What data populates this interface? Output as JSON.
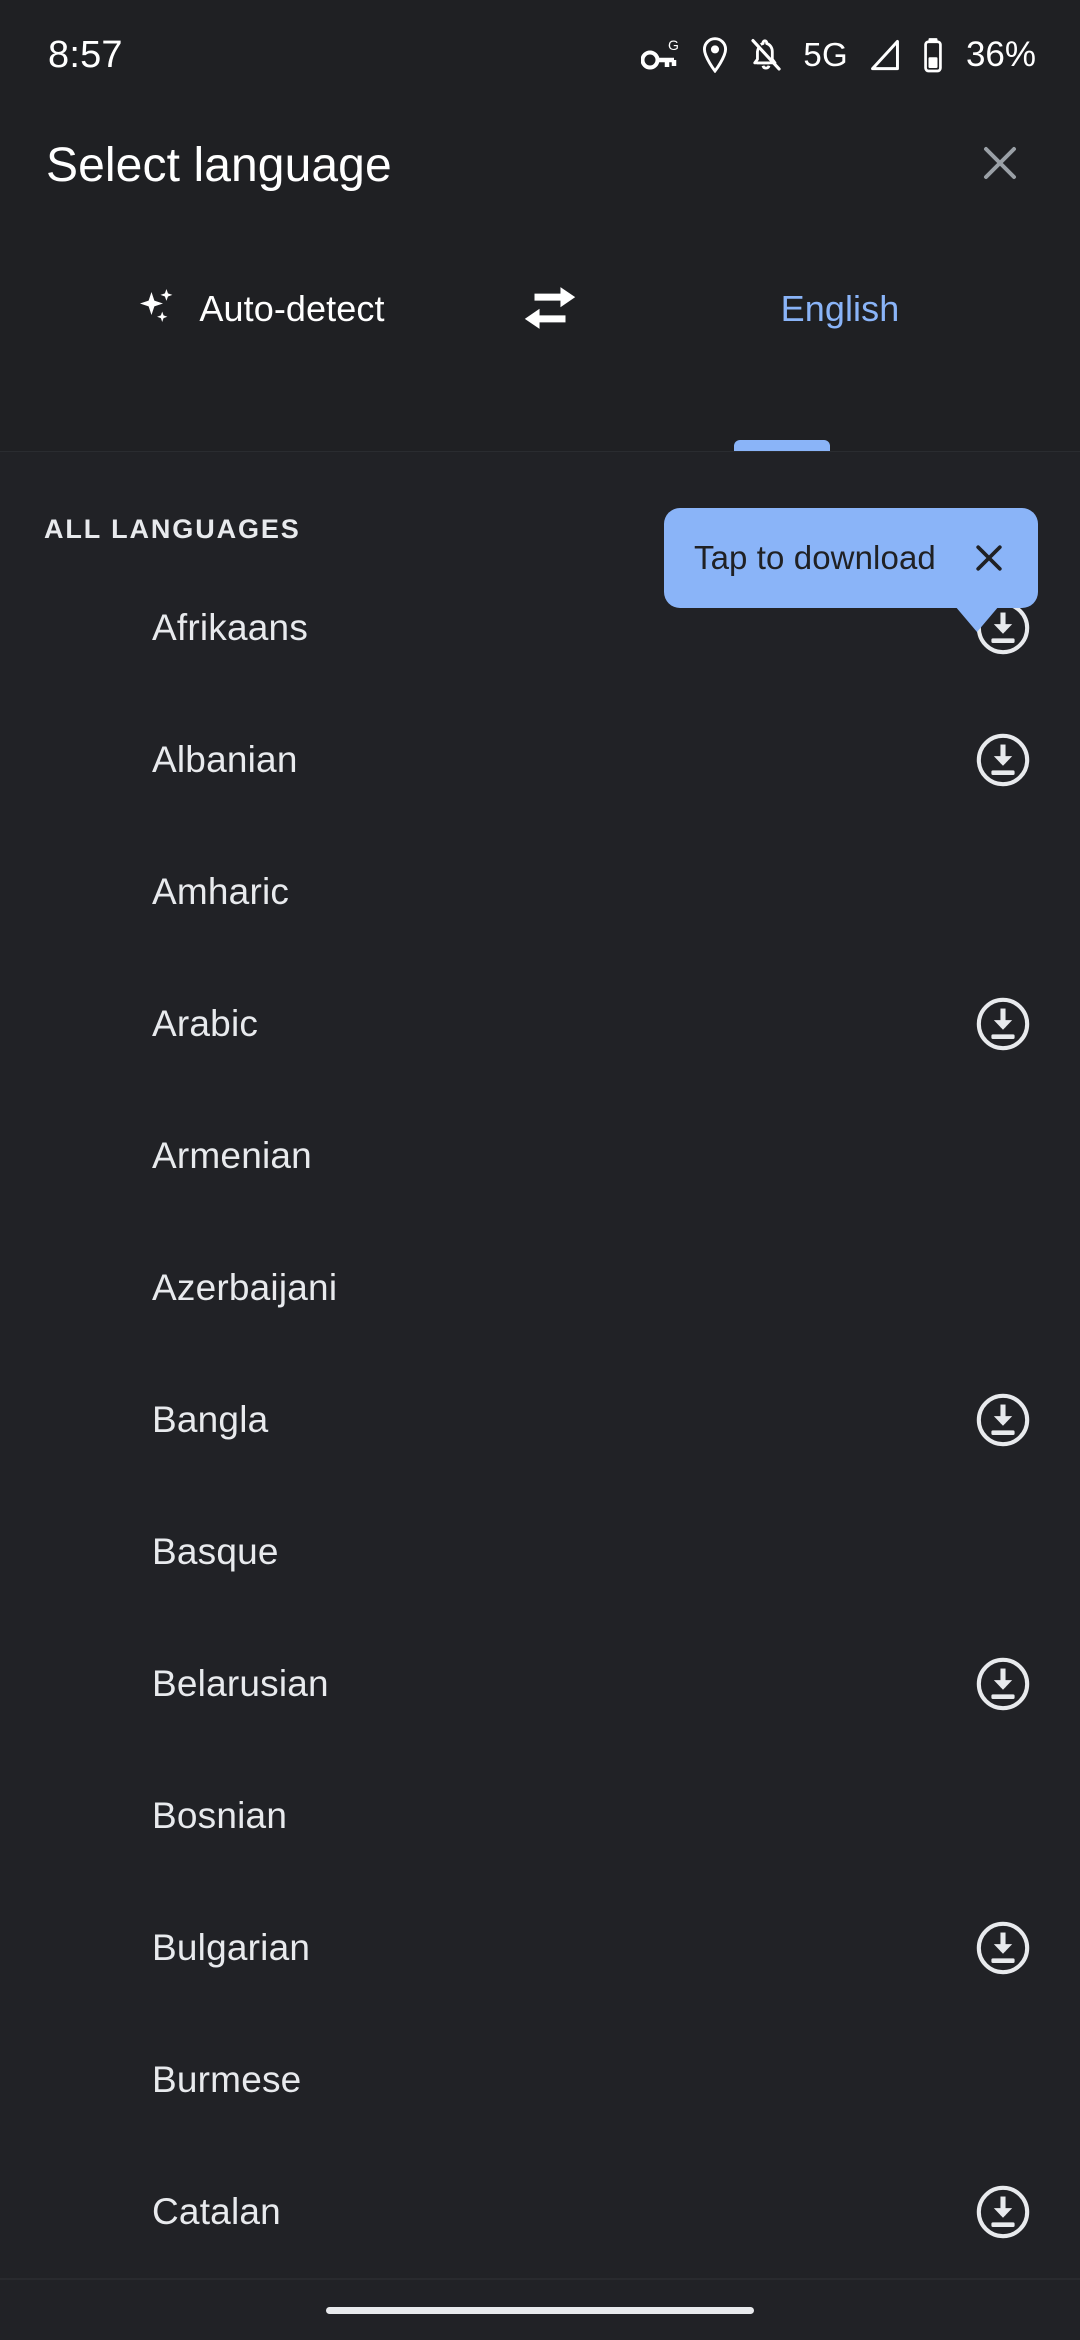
{
  "status_bar": {
    "time": "8:57",
    "battery_percent": "36%",
    "network_type": "5G",
    "icons": [
      "vpn-key-g-icon",
      "location-pin-icon",
      "notifications-off-icon",
      "signal-cellular-icon",
      "battery-icon"
    ]
  },
  "header": {
    "title": "Select language",
    "close_label": "close-icon"
  },
  "tabs": {
    "source": {
      "label": "Auto-detect",
      "icon": "auto-detect-sparkle-icon",
      "active": false
    },
    "swap": {
      "icon": "swap-horizontal-icon"
    },
    "target": {
      "label": "English",
      "active": true
    }
  },
  "tooltip": {
    "text": "Tap to download",
    "close_label": "close-icon",
    "background_color": "#8ab4f8",
    "text_color": "#202124"
  },
  "list": {
    "section_header": "All languages",
    "items": [
      {
        "name": "Afrikaans",
        "downloadable": true
      },
      {
        "name": "Albanian",
        "downloadable": true
      },
      {
        "name": "Amharic",
        "downloadable": false
      },
      {
        "name": "Arabic",
        "downloadable": true
      },
      {
        "name": "Armenian",
        "downloadable": false
      },
      {
        "name": "Azerbaijani",
        "downloadable": false
      },
      {
        "name": "Bangla",
        "downloadable": true
      },
      {
        "name": "Basque",
        "downloadable": false
      },
      {
        "name": "Belarusian",
        "downloadable": true
      },
      {
        "name": "Bosnian",
        "downloadable": false
      },
      {
        "name": "Bulgarian",
        "downloadable": true
      },
      {
        "name": "Burmese",
        "downloadable": false
      },
      {
        "name": "Catalan",
        "downloadable": true
      }
    ]
  },
  "colors": {
    "background": "#1f2023",
    "list_background": "#212226",
    "accent": "#8ab4f8",
    "text_primary": "#e8eaed"
  },
  "nav_bar": {
    "home_indicator": "home-indicator"
  }
}
